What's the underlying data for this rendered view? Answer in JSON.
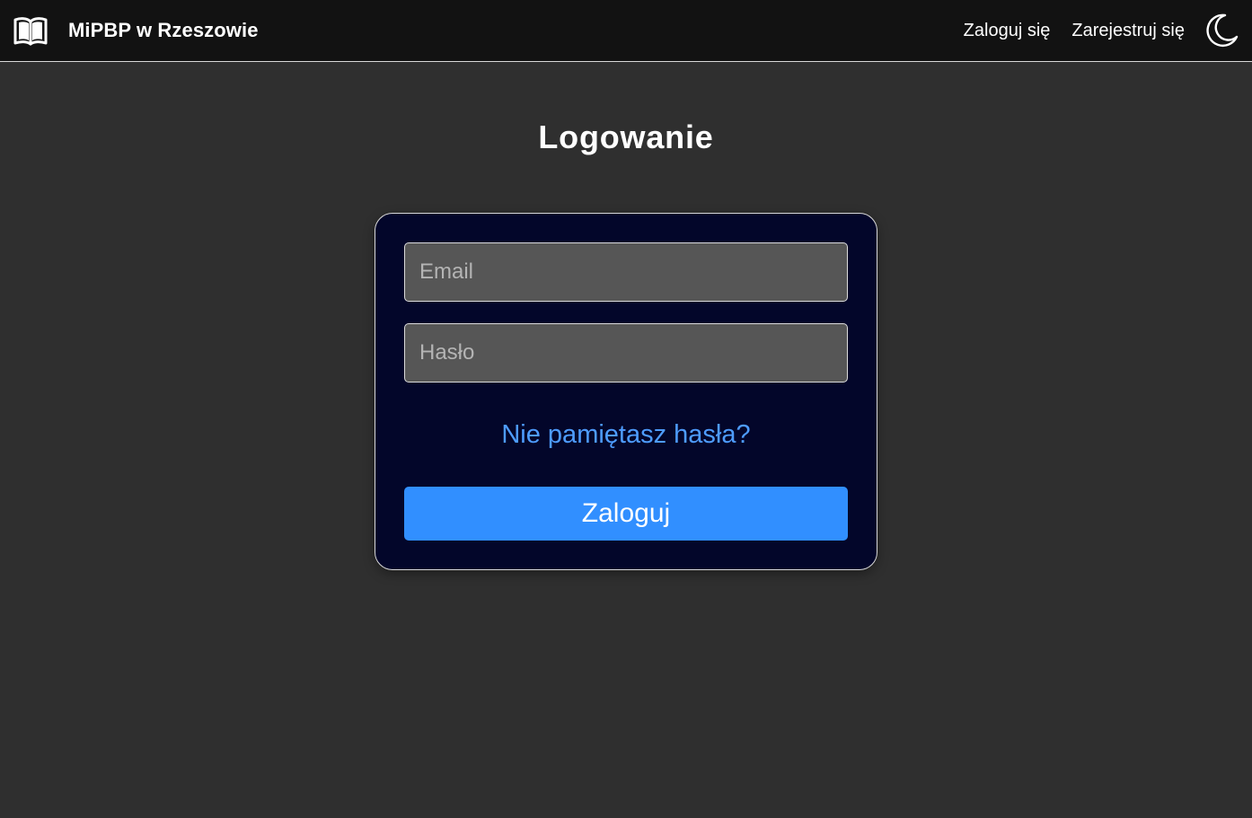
{
  "navbar": {
    "brand_icon": "open-book-icon",
    "brand_name": "MiPBP w Rzeszowie",
    "login_label": "Zaloguj się",
    "register_label": "Zarejestruj się",
    "theme_icon": "moon-icon"
  },
  "page": {
    "title": "Logowanie"
  },
  "form": {
    "email_placeholder": "Email",
    "email_value": "",
    "password_placeholder": "Hasło",
    "password_value": "",
    "forgot_label": "Nie pamiętasz hasła?",
    "submit_label": "Zaloguj"
  },
  "colors": {
    "page_background": "#2f2f2f",
    "navbar_background": "#121212",
    "card_background": "#03062a",
    "input_background": "#565656",
    "link": "#4e9cff",
    "primary_button": "#318fff"
  }
}
